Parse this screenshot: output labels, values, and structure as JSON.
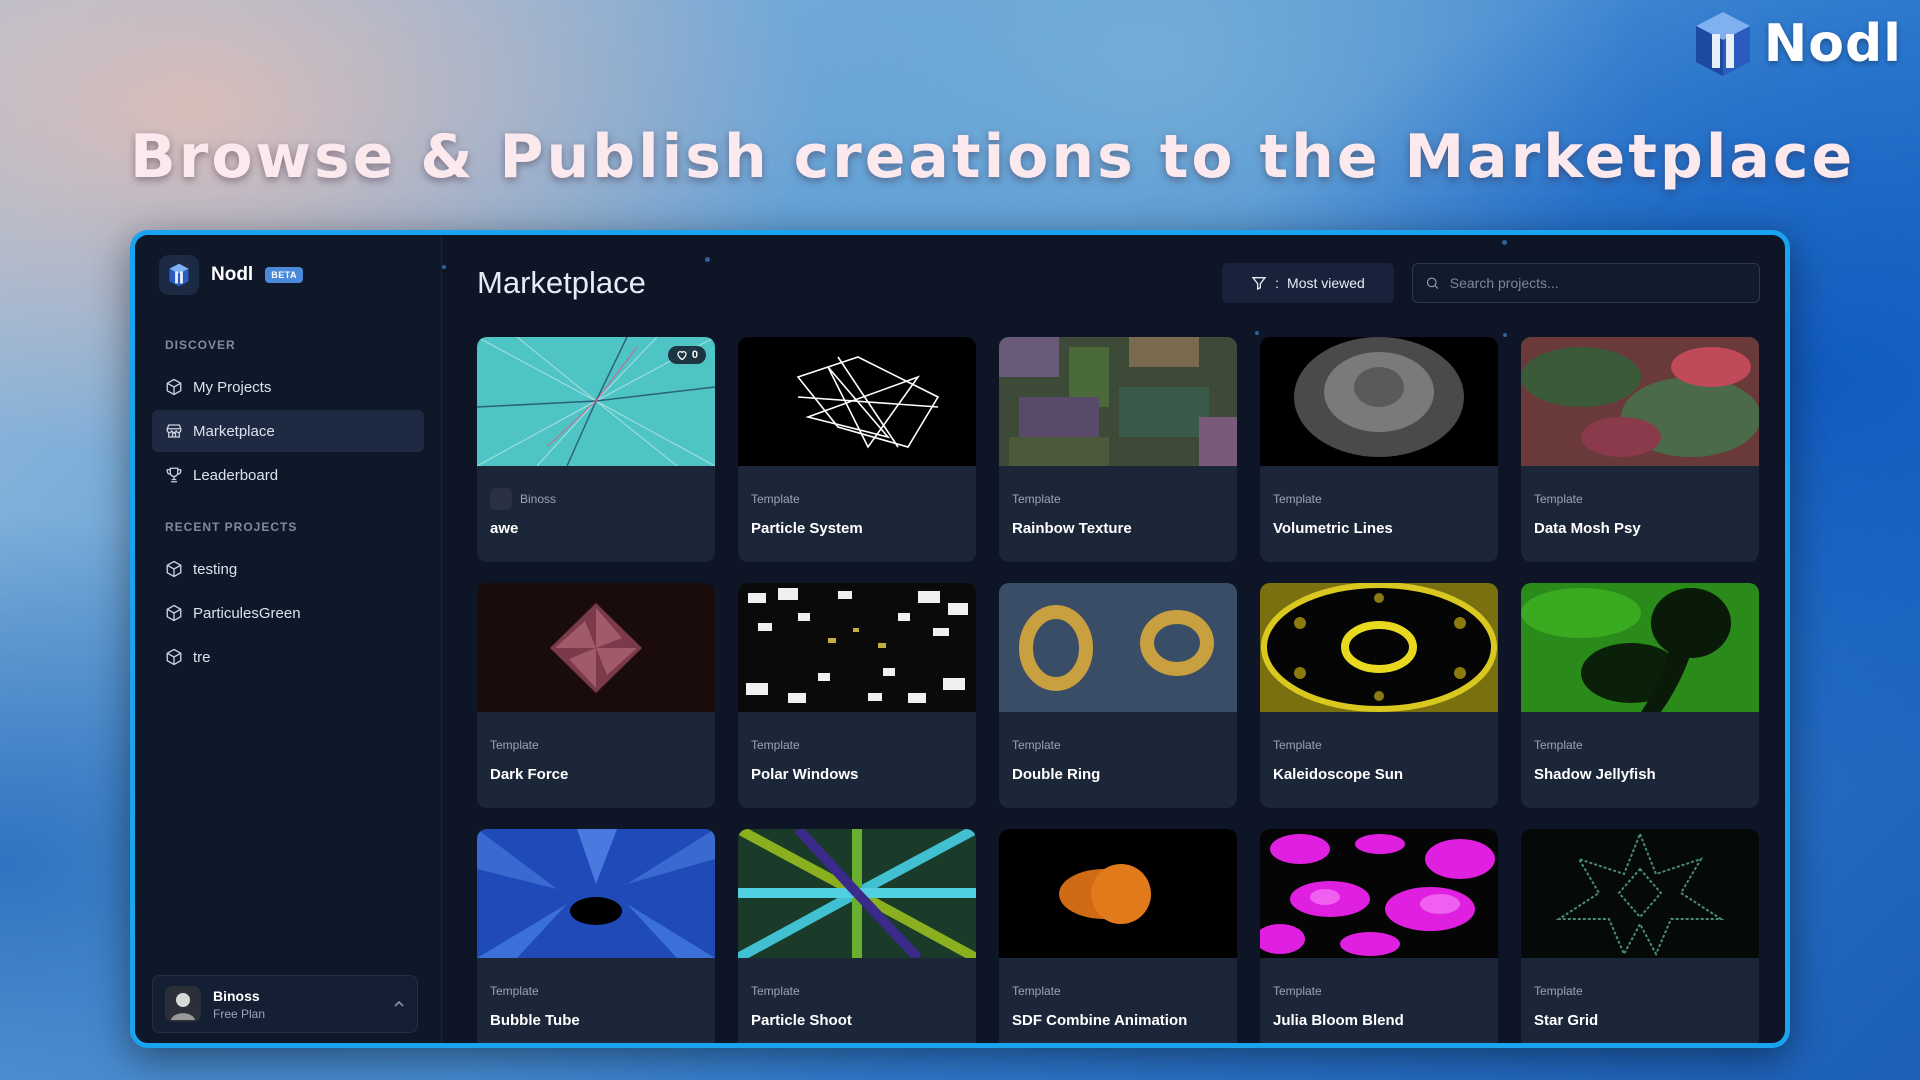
{
  "brand": {
    "name": "Nodl"
  },
  "headline": "Browse & Publish creations to the Marketplace",
  "app": {
    "name": "Nodl",
    "badge": "BETA"
  },
  "sidebar": {
    "discover_label": "DISCOVER",
    "discover_items": [
      {
        "label": "My Projects",
        "icon": "cube-icon"
      },
      {
        "label": "Marketplace",
        "icon": "store-icon",
        "active": true
      },
      {
        "label": "Leaderboard",
        "icon": "trophy-icon"
      }
    ],
    "recent_label": "RECENT PROJECTS",
    "recent_items": [
      {
        "label": "testing",
        "icon": "cube-icon"
      },
      {
        "label": "ParticulesGreen",
        "icon": "cube-icon"
      },
      {
        "label": "tre",
        "icon": "cube-icon"
      }
    ],
    "user": {
      "name": "Binoss",
      "plan": "Free Plan"
    }
  },
  "main": {
    "title": "Marketplace",
    "filter": {
      "separator": ":",
      "label": "Most viewed"
    },
    "search": {
      "placeholder": "Search projects..."
    }
  },
  "cards": [
    {
      "kind": "Binoss",
      "title": "awe",
      "likes": "0"
    },
    {
      "kind": "Template",
      "title": "Particle System"
    },
    {
      "kind": "Template",
      "title": "Rainbow Texture"
    },
    {
      "kind": "Template",
      "title": "Volumetric Lines"
    },
    {
      "kind": "Template",
      "title": "Data Mosh Psy"
    },
    {
      "kind": "Template",
      "title": "Dark Force"
    },
    {
      "kind": "Template",
      "title": "Polar Windows"
    },
    {
      "kind": "Template",
      "title": "Double Ring"
    },
    {
      "kind": "Template",
      "title": "Kaleidoscope Sun"
    },
    {
      "kind": "Template",
      "title": "Shadow Jellyfish"
    },
    {
      "kind": "Template",
      "title": "Bubble Tube"
    },
    {
      "kind": "Template",
      "title": "Particle Shoot"
    },
    {
      "kind": "Template",
      "title": "SDF Combine Animation"
    },
    {
      "kind": "Template",
      "title": "Julia Bloom Blend"
    },
    {
      "kind": "Template",
      "title": "Star Grid"
    }
  ],
  "colors": {
    "accent": "#1aa3ee",
    "window_bg": "#0d1526",
    "card_bg": "#1c2639",
    "beta": "#4a8ad8"
  }
}
